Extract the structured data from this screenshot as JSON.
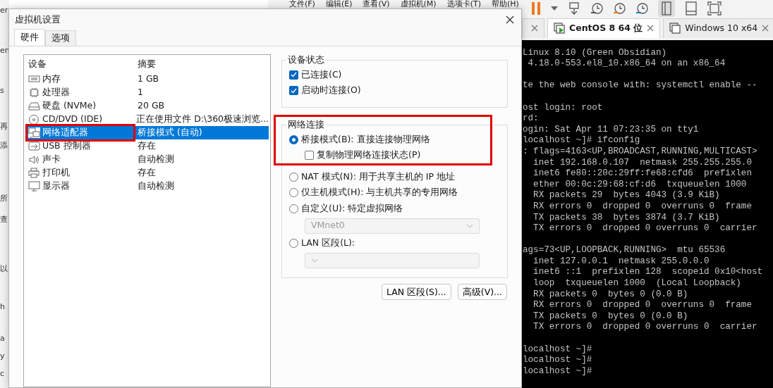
{
  "background_app": {
    "fragments": [
      "er",
      "en",
      "s",
      "再",
      "添",
      "所",
      "查",
      "以",
      "h",
      "a",
      "y",
      "c"
    ]
  },
  "vmware": {
    "menu": [
      "文件(F)",
      "编辑(E)",
      "查看(V)",
      "虚拟机(M)",
      "选项卡(T)",
      "帮助(H)"
    ],
    "tabs": [
      {
        "selected": false
      },
      {
        "label": "CentOS 8 64 位",
        "selected": true
      },
      {
        "label": "Windows 10 x64",
        "selected": false
      }
    ],
    "terminal": {
      "blocks": [
        [
          "Linux 8.10 (Green Obsidian)",
          " 4.18.0-553.el8_10.x86_64 on an x86_64"
        ],
        [
          "te the web console with: systemctl enable --"
        ],
        [
          "ost login: root",
          "rd:",
          "ogin: Sat Apr 11 07:23:35 on tty1",
          "localhost ~]# ifconfig",
          ": flags=4163<UP,BROADCAST,RUNNING,MULTICAST>",
          "  inet 192.168.0.107  netmask 255.255.255.0",
          "  inet6 fe80::20c:29ff:fe68:cfd6  prefixlen",
          "  ether 00:0c:29:68:cf:d6  txqueuelen 1000",
          "  RX packets 29  bytes 4043 (3.9 KiB)",
          "  RX errors 0  dropped 0  overruns 0  frame",
          "  TX packets 38  bytes 3874 (3.7 KiB)",
          "  TX errors 0  dropped 0 overruns 0  carrier"
        ],
        [
          "ags=73<UP,LOOPBACK,RUNNING>  mtu 65536",
          "  inet 127.0.0.1  netmask 255.0.0.0",
          "  inet6 ::1  prefixlen 128  scopeid 0x10<host",
          "  loop  txqueuelen 1000  (Local Loopback)",
          "  RX packets 0  bytes 0 (0.0 B)",
          "  RX errors 0  dropped 0  overruns 0  frame",
          "  TX packets 0  bytes 0 (0.0 B)",
          "  TX errors 0  dropped 0 overruns 0  carrier"
        ],
        [
          "localhost ~]#",
          "localhost ~]#",
          "localhost ~]#"
        ]
      ]
    }
  },
  "dialog": {
    "title": "虚拟机设置",
    "tabs": [
      {
        "label": "硬件",
        "selected": true
      },
      {
        "label": "选项",
        "selected": false
      }
    ],
    "device_table": {
      "columns": [
        "设备",
        "摘要"
      ],
      "rows": [
        {
          "kind": "memory",
          "device": "内存",
          "summary": "1 GB",
          "selected": false,
          "highlighted": false
        },
        {
          "kind": "cpu",
          "device": "处理器",
          "summary": "1",
          "selected": false,
          "highlighted": false
        },
        {
          "kind": "disk",
          "device": "硬盘 (NVMe)",
          "summary": "20 GB",
          "selected": false,
          "highlighted": false
        },
        {
          "kind": "cd",
          "device": "CD/DVD (IDE)",
          "summary": "正在使用文件 D:\\360极速浏览...",
          "selected": false,
          "highlighted": false
        },
        {
          "kind": "network",
          "device": "网络适配器",
          "summary": "桥接模式 (自动)",
          "selected": true,
          "highlighted": true
        },
        {
          "kind": "usb",
          "device": "USB 控制器",
          "summary": "存在",
          "selected": false,
          "highlighted": false
        },
        {
          "kind": "sound",
          "device": "声卡",
          "summary": "自动检测",
          "selected": false,
          "highlighted": false
        },
        {
          "kind": "printer",
          "device": "打印机",
          "summary": "存在",
          "selected": false,
          "highlighted": false
        },
        {
          "kind": "display",
          "device": "显示器",
          "summary": "自动检测",
          "selected": false,
          "highlighted": false
        }
      ]
    },
    "device_status": {
      "title": "设备状态",
      "options": [
        {
          "label": "已连接(C)",
          "checked": true
        },
        {
          "label": "启动时连接(O)",
          "checked": true
        }
      ]
    },
    "network": {
      "title": "网络连接",
      "highlighted": true,
      "options": [
        {
          "kind": "radio",
          "label": "桥接模式(B): 直接连接物理网络",
          "selected": true
        },
        {
          "kind": "checkbox",
          "label": "复制物理网络连接状态(P)",
          "checked": false
        },
        {
          "kind": "radio",
          "label": "NAT 模式(N): 用于共享主机的 IP 地址",
          "selected": false
        },
        {
          "kind": "radio",
          "label": "仅主机模式(H): 与主机共享的专用网络",
          "selected": false
        },
        {
          "kind": "radio",
          "label": "自定义(U): 特定虚拟网络",
          "selected": false
        },
        {
          "kind": "select",
          "value": "VMnet0",
          "disabled": true
        },
        {
          "kind": "radio",
          "label": "LAN 区段(L):",
          "selected": false
        },
        {
          "kind": "select",
          "disabled": true
        }
      ]
    },
    "buttons": [
      "LAN 区段(S)...",
      "高级(V)..."
    ]
  }
}
